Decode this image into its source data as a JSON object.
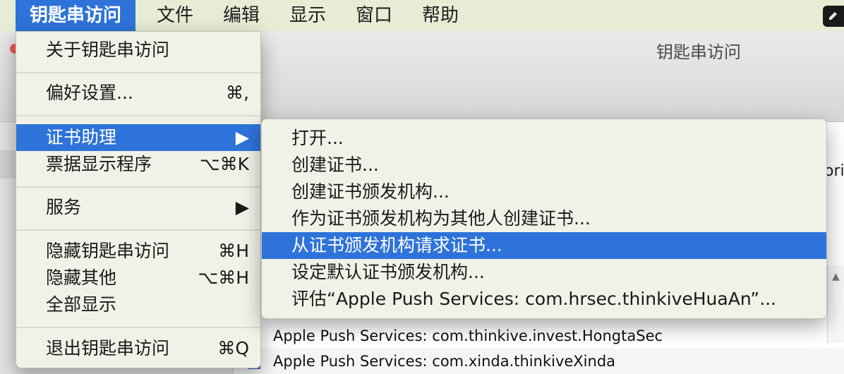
{
  "menubar": {
    "app_name": "钥匙串访问",
    "items": [
      "文件",
      "编辑",
      "显示",
      "窗口",
      "帮助"
    ]
  },
  "window": {
    "title": "钥匙串访问",
    "partial_text": "ori"
  },
  "app_menu": {
    "items": [
      {
        "label": "关于钥匙串访问",
        "shortcut": ""
      },
      {
        "label": "偏好设置...",
        "shortcut": "⌘,"
      },
      {
        "label": "证书助理",
        "shortcut": "▶"
      },
      {
        "label": "票据显示程序",
        "shortcut": "⌥⌘K"
      },
      {
        "label": "服务",
        "shortcut": "▶"
      },
      {
        "label": "隐藏钥匙串访问",
        "shortcut": "⌘H"
      },
      {
        "label": "隐藏其他",
        "shortcut": "⌥⌘H"
      },
      {
        "label": "全部显示",
        "shortcut": ""
      },
      {
        "label": "退出钥匙串访问",
        "shortcut": "⌘Q"
      }
    ]
  },
  "cert_assistant_submenu": {
    "items": [
      "打开...",
      "创建证书...",
      "创建证书颁发机构...",
      "作为证书颁发机构为其他人创建证书...",
      "从证书颁发机构请求证书...",
      "设定默认证书颁发机构...",
      "评估“Apple Push Services: com.hrsec.thinkiveHuaAn”..."
    ]
  },
  "cert_list": {
    "rows": [
      "Apple Push Services: com.thinkive.invest.HongtaSec",
      "Apple Push Services: com.xinda.thinkiveXinda"
    ]
  },
  "colors": {
    "menubar_bg": "#e7ecd5",
    "menu_bg": "#f0f2e8",
    "highlight": "#2e73d9"
  }
}
